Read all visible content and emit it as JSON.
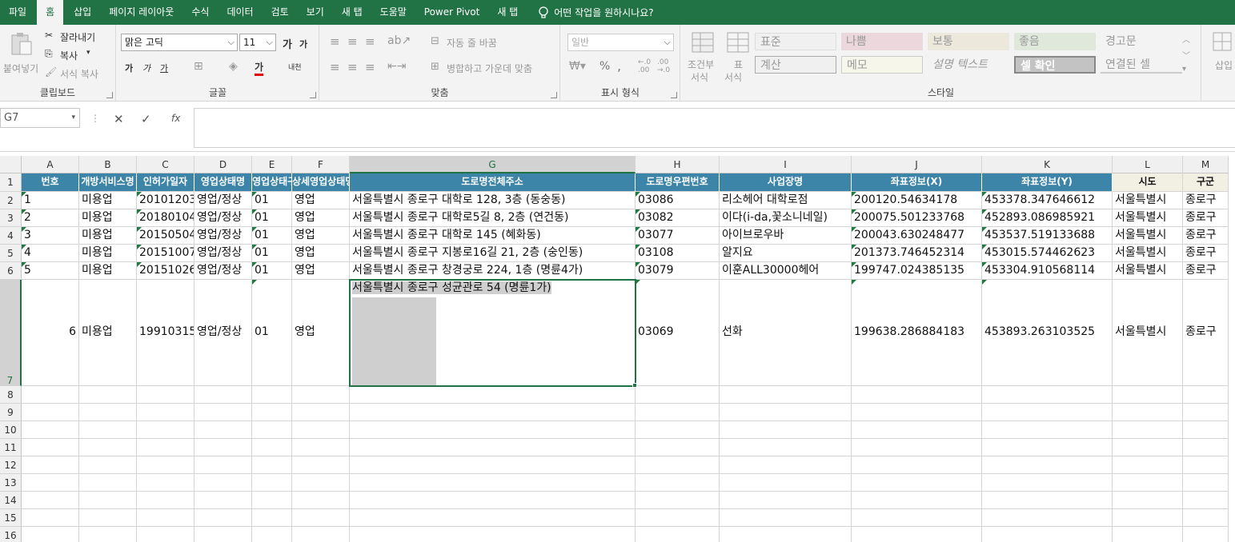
{
  "tabs": [
    "파일",
    "홈",
    "삽입",
    "페이지 레이아웃",
    "수식",
    "데이터",
    "검토",
    "보기",
    "새 탭",
    "도움말",
    "Power Pivot",
    "새 탭"
  ],
  "tell_me": "어떤 작업을 원하시나요?",
  "ribbon": {
    "clipboard": {
      "label": "클립보드",
      "paste": "붙여넣기",
      "cut": "잘라내기",
      "copy": "복사",
      "format_painter": "서식 복사"
    },
    "font": {
      "label": "글꼴",
      "name": "맑은 고딕",
      "size": "11",
      "grow": "가",
      "shrink": "가",
      "bold": "가",
      "italic": "가",
      "underline": "가",
      "color_letter": "가",
      "phonetic": "내천"
    },
    "align": {
      "label": "맞춤",
      "wrap": "자동 줄 바꿈",
      "merge": "병합하고 가운데 맞춤"
    },
    "number": {
      "label": "표시 형식",
      "format": "일반",
      "percent": "%",
      "comma": ",",
      "inc": "←.0 .00",
      "dec": ".00 →.0"
    },
    "cond": {
      "line1": "조건부",
      "line2": "서식"
    },
    "table": {
      "line1": "표",
      "line2": "서식"
    },
    "styles": {
      "label": "스타일",
      "items": [
        "표준",
        "나쁨",
        "보통",
        "좋음",
        "경고문",
        "계산",
        "메모",
        "설명 텍스트",
        "셀 확인",
        "연결된 셀"
      ]
    },
    "insert": "삽입"
  },
  "formula_bar": {
    "name_box": "G7",
    "cancel": "✕",
    "enter": "✓",
    "fx": "fx",
    "value": ""
  },
  "columns": [
    "A",
    "B",
    "C",
    "D",
    "E",
    "F",
    "G",
    "H",
    "I",
    "J",
    "K",
    "L",
    "M"
  ],
  "row_numbers": [
    "1",
    "2",
    "3",
    "4",
    "5",
    "6",
    "7",
    "8",
    "9",
    "10",
    "11",
    "12",
    "13",
    "14",
    "15",
    "16"
  ],
  "headers": [
    "번호",
    "개방서비스명",
    "인허가일자",
    "영업상태명",
    "영업상태구분코드",
    "상세영업상태명",
    "도로명전체주소",
    "도로명우편번호",
    "사업장명",
    "좌표정보(X)",
    "좌표정보(Y)",
    "시도",
    "구군"
  ],
  "rows": [
    [
      "1",
      "미용업",
      "20101203",
      "영업/정상",
      "01",
      "영업",
      "서울특별시 종로구 대학로 128, 3층 (동숭동)",
      "03086",
      "리소헤어 대학로점",
      "200120.54634178",
      "453378.347646612",
      "서울특별시",
      "종로구"
    ],
    [
      "2",
      "미용업",
      "20180104",
      "영업/정상",
      "01",
      "영업",
      "서울특별시 종로구 대학로5길 8, 2층 (연건동)",
      "03082",
      "이다(i-da,꽃소니네일)",
      "200075.501233768",
      "452893.086985921",
      "서울특별시",
      "종로구"
    ],
    [
      "3",
      "미용업",
      "20150504",
      "영업/정상",
      "01",
      "영업",
      "서울특별시 종로구 대학로 145 (혜화동)",
      "03077",
      "아이브로우바",
      "200043.630248477",
      "453537.519133688",
      "서울특별시",
      "종로구"
    ],
    [
      "4",
      "미용업",
      "20151007",
      "영업/정상",
      "01",
      "영업",
      "서울특별시 종로구 지봉로16길 21, 2층 (숭인동)",
      "03108",
      "알지요",
      "201373.746452314",
      "453015.574462623",
      "서울특별시",
      "종로구"
    ],
    [
      "5",
      "미용업",
      "20151026",
      "영업/정상",
      "01",
      "영업",
      "서울특별시 종로구 창경궁로 224, 1층 (명륜4가)",
      "03079",
      "이훈ALL30000헤어",
      "199747.024385135",
      "453304.910568114",
      "서울특별시",
      "종로구"
    ],
    [
      "6",
      "미용업",
      "19910315",
      "영업/정상",
      "01",
      "영업",
      "서울특별시 종로구 성균관로 54 (명륜1가)",
      "03069",
      "선화",
      "199638.286884183",
      "453893.263103525",
      "서울특별시",
      "종로구"
    ]
  ],
  "colors": {
    "ribbon_green": "#217346",
    "header_blue": "#3d85a8",
    "header_beige": "#f2efe3"
  }
}
